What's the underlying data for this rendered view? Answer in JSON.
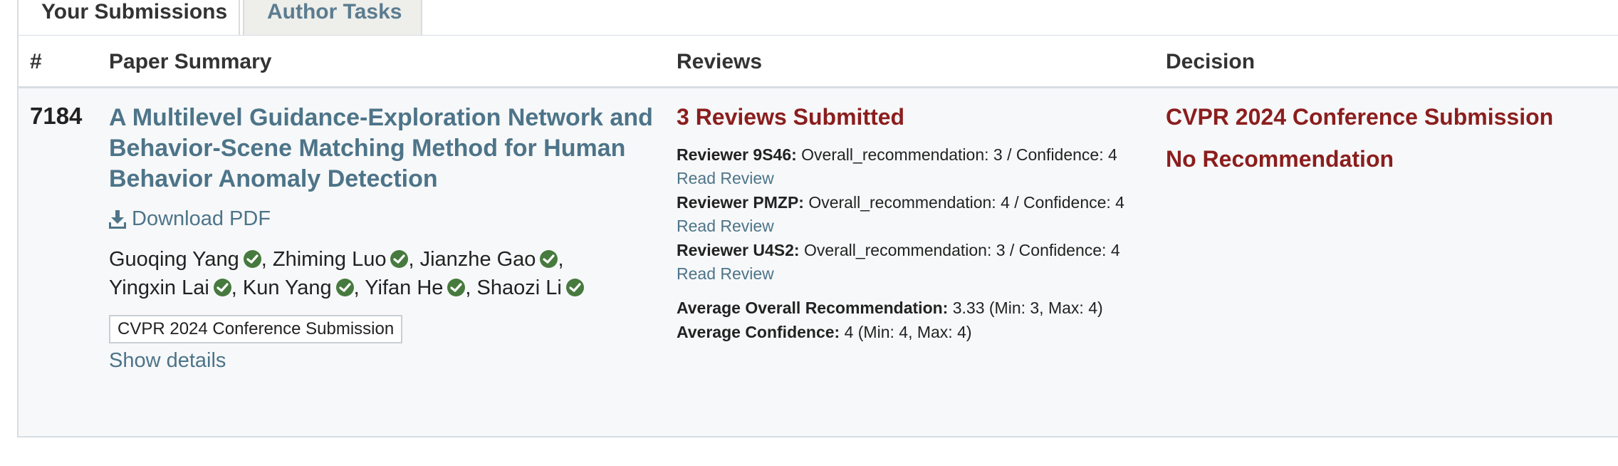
{
  "tabs": [
    {
      "label": "Your Submissions",
      "active": true
    },
    {
      "label": "Author Tasks",
      "active": false
    }
  ],
  "table": {
    "headers": {
      "num": "#",
      "summary": "Paper Summary",
      "reviews": "Reviews",
      "decision": "Decision"
    }
  },
  "submission": {
    "number": "7184",
    "title": "A Multilevel Guidance-Exploration Network and Behavior-Scene Matching Method for Human Behavior Anomaly Detection",
    "download_label": "Download PDF",
    "authors": [
      "Guoqing Yang",
      "Zhiming Luo",
      "Jianzhe Gao",
      "Yingxin Lai",
      "Kun Yang",
      "Yifan He",
      "Shaozi Li"
    ],
    "venue_badge": "CVPR 2024 Conference Submission",
    "show_details": "Show details",
    "reviews_title": "3 Reviews Submitted",
    "reviews": [
      {
        "reviewer": "Reviewer 9S46:",
        "text": "Overall_recommendation: 3 / Confidence: 4",
        "read": "Read Review"
      },
      {
        "reviewer": "Reviewer PMZP:",
        "text": "Overall_recommendation: 4 / Confidence: 4",
        "read": "Read Review"
      },
      {
        "reviewer": "Reviewer U4S2:",
        "text": "Overall_recommendation: 3 / Confidence: 4",
        "read": "Read Review"
      }
    ],
    "avg_rec_label": "Average Overall Recommendation:",
    "avg_rec_value": "3.33 (Min: 3, Max: 4)",
    "avg_conf_label": "Average Confidence:",
    "avg_conf_value": "4 (Min: 4, Max: 4)",
    "decision_venue": "CVPR 2024 Conference Submission",
    "decision": "No Recommendation"
  },
  "colors": {
    "link": "#4d7489",
    "decision": "#8b1e1e",
    "verified": "#477a3e"
  },
  "icons": {
    "download": "download-icon",
    "verified": "verified-check-icon"
  }
}
